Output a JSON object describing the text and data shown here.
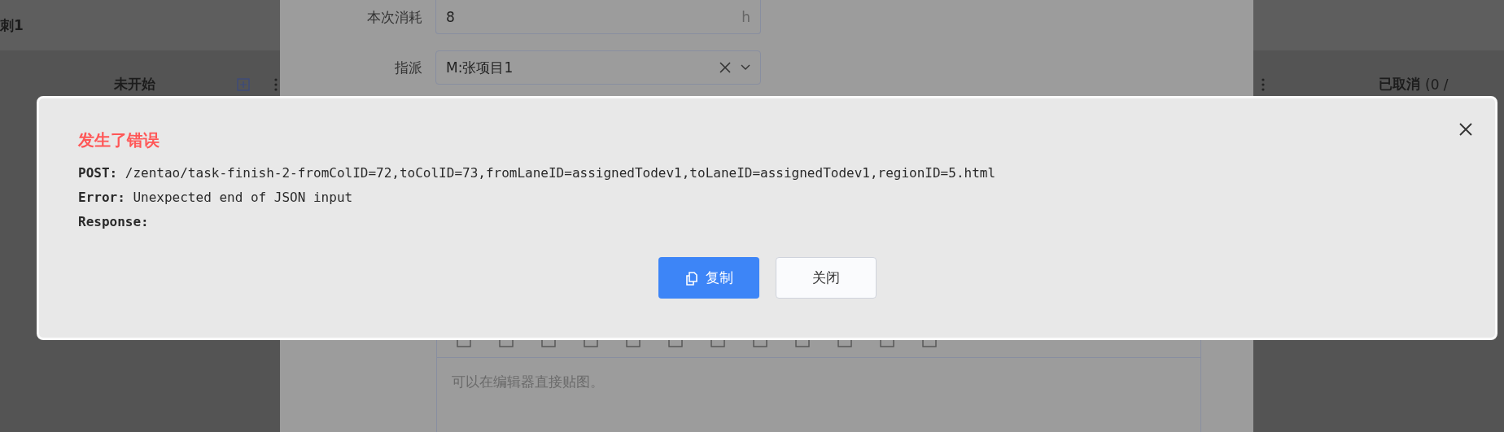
{
  "board": {
    "title": "刺1",
    "columns": [
      {
        "title": "未开始"
      },
      {
        "title": "已取消",
        "count": "(0 /"
      }
    ]
  },
  "task_form": {
    "fields": [
      {
        "kind": "input",
        "label": "本次消耗",
        "value": "8",
        "unit": "h"
      },
      {
        "kind": "select",
        "label": "指派",
        "value": "M:张项目1"
      }
    ],
    "editor": {
      "placeholder": "可以在编辑器直接贴图。"
    }
  },
  "error_dialog": {
    "title": "发生了错误",
    "lines": [
      {
        "label": "POST:",
        "text": "/zentao/task-finish-2-fromColID=72,toColID=73,fromLaneID=assignedTodev1,toLaneID=assignedTodev1,regionID=5.html"
      },
      {
        "label": "Error:",
        "text": "Unexpected end of JSON input"
      },
      {
        "label": "Response:"
      }
    ],
    "buttons": [
      {
        "label": "复制",
        "kind": "primary"
      },
      {
        "label": "关闭",
        "kind": "default"
      }
    ]
  }
}
